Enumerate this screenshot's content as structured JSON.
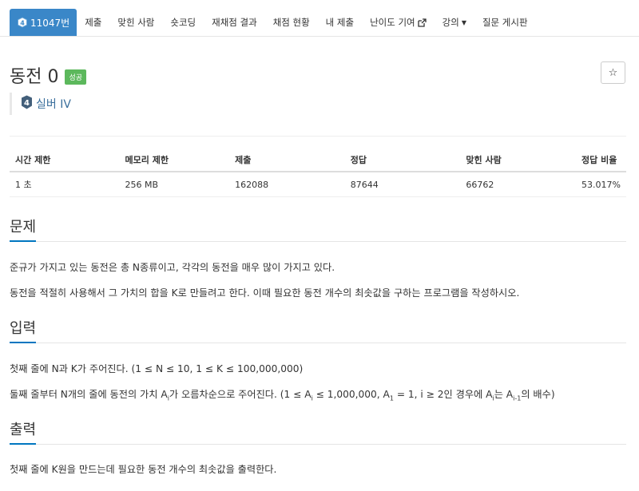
{
  "nav": {
    "problem_id": "11047번",
    "tabs": [
      "제출",
      "맞힌 사람",
      "숏코딩",
      "재채점 결과",
      "채점 현황",
      "내 제출",
      "난이도 기여",
      "강의",
      "질문 게시판"
    ]
  },
  "problem": {
    "title": "동전 0",
    "status": "성공",
    "tier": "실버 IV",
    "tier_color": "#435f7a"
  },
  "info_table": {
    "headers": [
      "시간 제한",
      "메모리 제한",
      "제출",
      "정답",
      "맞힌 사람",
      "정답 비율"
    ],
    "values": [
      "1 초",
      "256 MB",
      "162088",
      "87644",
      "66762",
      "53.017%"
    ]
  },
  "sections": {
    "problem": {
      "heading": "문제",
      "lines": [
        "준규가 가지고 있는 동전은 총 N종류이고, 각각의 동전을 매우 많이 가지고 있다.",
        "동전을 적절히 사용해서 그 가치의 합을 K로 만들려고 한다. 이때 필요한 동전 개수의 최솟값을 구하는 프로그램을 작성하시오."
      ]
    },
    "input": {
      "heading": "입력",
      "line1": "첫째 줄에 N과 K가 주어진다. (1 ≤ N ≤ 10, 1 ≤ K ≤ 100,000,000)",
      "line2_parts": [
        "둘째 줄부터 N개의 줄에 동전의 가치 A",
        "i",
        "가 오름차순으로 주어진다. (1 ≤ A",
        "i",
        " ≤ 1,000,000, A",
        "1",
        " = 1, i ≥ 2인 경우에 A",
        "i",
        "는 A",
        "i-1",
        "의 배수)"
      ]
    },
    "output": {
      "heading": "출력",
      "line": "첫째 줄에 K원을 만드는데 필요한 동전 개수의 최솟값을 출력한다."
    }
  }
}
